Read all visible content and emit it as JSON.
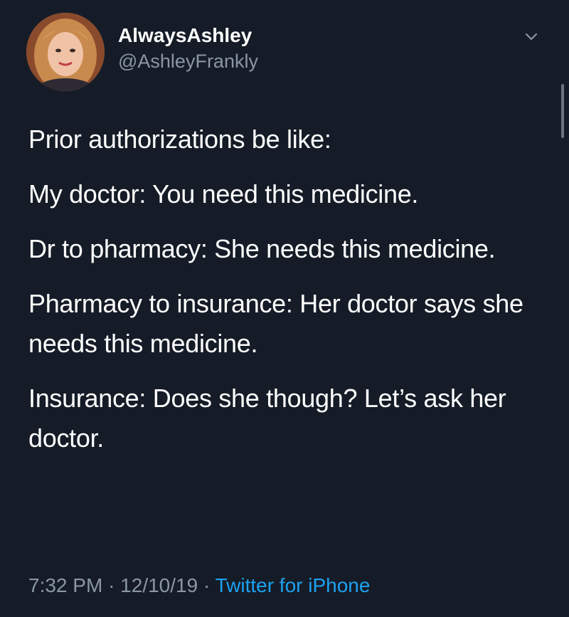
{
  "tweet": {
    "author": {
      "display_name": "AlwaysAshley",
      "handle": "@AshleyFrankly",
      "avatar": "profile-photo"
    },
    "menu_icon": "chevron-down-icon",
    "paragraphs": [
      "Prior authorizations be like:",
      "My doctor: You need this medicine.",
      "Dr to pharmacy: She needs this medicine.",
      "Pharmacy to insurance: Her doctor says she needs this medicine.",
      "Insurance: Does she though? Let’s ask her doctor."
    ],
    "meta": {
      "time": "7:32 PM",
      "separator": "·",
      "date": "12/10/19",
      "source": "Twitter for iPhone"
    }
  },
  "colors": {
    "background": "#151c27",
    "text": "#ffffff",
    "secondary_text": "#8a96a6",
    "link": "#1da1f2"
  }
}
